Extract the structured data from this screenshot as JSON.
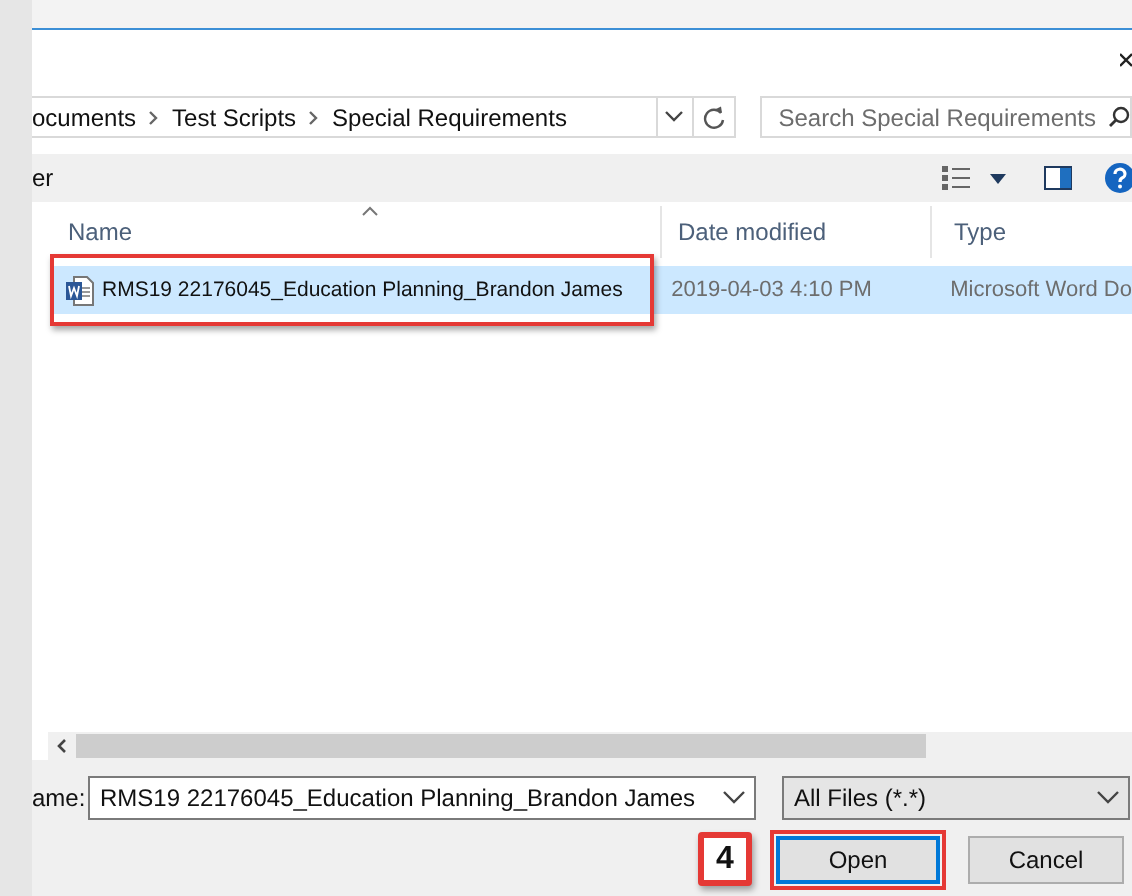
{
  "address_bar": {
    "breadcrumbs": [
      {
        "label": "ocuments"
      },
      {
        "label": "Test Scripts"
      },
      {
        "label": "Special Requirements"
      }
    ]
  },
  "search": {
    "placeholder": "Search Special Requirements"
  },
  "toolbar": {
    "label": "er"
  },
  "columns": [
    {
      "label": "Name",
      "sorted": true
    },
    {
      "label": "Date modified",
      "sorted": false
    },
    {
      "label": "Type",
      "sorted": false
    }
  ],
  "files": [
    {
      "name": "RMS19 22176045_Education Planning_Brandon James",
      "date": "2019-04-03 4:10 PM",
      "type": "Microsoft Word Do",
      "selected": true,
      "annotated": true
    }
  ],
  "file_name": {
    "label": "ame:",
    "value": "RMS19 22176045_Education Planning_Brandon James"
  },
  "file_type": {
    "value": "All Files (*.*)"
  },
  "step_badge": "4",
  "buttons": [
    {
      "label": "Open",
      "annotated": true
    },
    {
      "label": "Cancel"
    }
  ]
}
